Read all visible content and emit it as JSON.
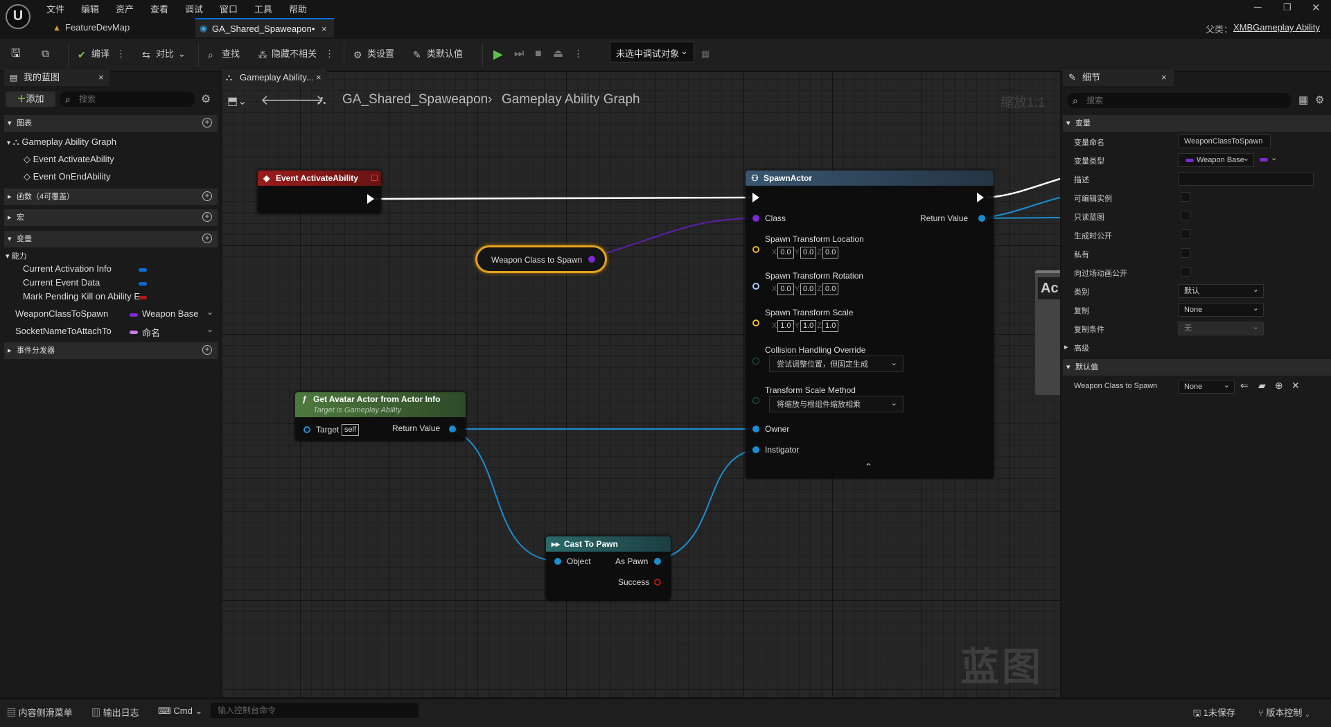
{
  "menu": {
    "items": [
      "文件",
      "编辑",
      "资产",
      "查看",
      "调试",
      "窗口",
      "工具",
      "帮助"
    ]
  },
  "doc_tabs": [
    {
      "label": "FeatureDevMap"
    },
    {
      "label": "GA_Shared_Spaweapon•"
    }
  ],
  "parent_class": {
    "label": "父类：",
    "value": "XMBGameplay Ability"
  },
  "toolbar": {
    "compile": "编译",
    "diff": "对比",
    "find": "查找",
    "hide_unrelated": "隐藏不相关",
    "class_settings": "类设置",
    "class_defaults": "类默认值",
    "debug_target": "未选中调试对象"
  },
  "my_blueprint": {
    "tab": "我的蓝图",
    "add": "添加",
    "search_placeholder": "搜索",
    "graphs_cat": "图表",
    "graph_name": "Gameplay Ability Graph",
    "events": [
      "Event ActivateAbility",
      "Event OnEndAbility"
    ],
    "functions_cat": "函数（4可覆盖）",
    "macros_cat": "宏",
    "variables_cat": "变量",
    "ability_group": "能力",
    "ability_vars": [
      {
        "name": "Current Activation Info",
        "color": "#0a6bd8"
      },
      {
        "name": "Current Event Data",
        "color": "#0a6bd8"
      },
      {
        "name": "Mark Pending Kill on Ability E",
        "color": "#b01818"
      }
    ],
    "vars": [
      {
        "name": "WeaponClassToSpawn",
        "type": "Weapon Base",
        "color": "#7a2bd6"
      },
      {
        "name": "SocketNameToAttachTo",
        "type": "命名",
        "color": "#c77ae8"
      }
    ],
    "dispatchers_cat": "事件分发器"
  },
  "graph": {
    "tab": "Gameplay Ability...",
    "breadcrumb": [
      "GA_Shared_Spaweapon",
      "Gameplay Ability Graph"
    ],
    "zoom": "缩放1:1",
    "watermark": "蓝图",
    "event_node": {
      "title": "Event ActivateAbility"
    },
    "var_node": {
      "label": "Weapon Class to Spawn"
    },
    "spawn_node": {
      "title": "SpawnActor",
      "class": "Class",
      "return_value": "Return Value",
      "loc": "Spawn Transform Location",
      "rot": "Spawn Transform Rotation",
      "scale": "Spawn Transform Scale",
      "loc_vals": [
        "0.0",
        "0.0",
        "0.0"
      ],
      "rot_vals": [
        "0.0",
        "0.0",
        "0.0"
      ],
      "scale_vals": [
        "1.0",
        "1.0",
        "1.0"
      ],
      "axes": [
        "X",
        "Y",
        "Z"
      ],
      "collision": "Collision Handling Override",
      "collision_val": "尝试调整位置，但固定生成",
      "scale_method": "Transform Scale Method",
      "scale_method_val": "将缩放与根组件缩放相乘",
      "owner": "Owner",
      "instigator": "Instigator"
    },
    "avatar_node": {
      "title": "Get Avatar Actor from Actor Info",
      "subtitle": "Target is Gameplay Ability",
      "target": "Target",
      "target_val": "self",
      "return_value": "Return Value"
    },
    "cast_node": {
      "title": "Cast To Pawn",
      "object": "Object",
      "as_pawn": "As Pawn",
      "success": "Success"
    },
    "partial_node": {
      "label": "Ac"
    }
  },
  "details": {
    "tab": "细节",
    "search_placeholder": "搜索",
    "var_cat": "变量",
    "var_name_label": "变量命名",
    "var_name": "WeaponClassToSpawn",
    "var_type_label": "变量类型",
    "var_type": "Weapon Base",
    "desc_label": "描述",
    "checks": [
      "可编辑实例",
      "只读蓝图",
      "生成时公开",
      "私有",
      "向过场动画公开"
    ],
    "category_label": "类别",
    "category": "默认",
    "replication_label": "复制",
    "replication": "None",
    "rep_cond_label": "复制条件",
    "rep_cond": "无",
    "advanced": "高级",
    "defaults_cat": "默认值",
    "default_var": "Weapon Class to Spawn",
    "default_val": "None"
  },
  "status": {
    "drawer": "内容侧滑菜单",
    "log": "输出日志",
    "cmd": "Cmd",
    "console_placeholder": "输入控制台命令",
    "unsaved": "1未保存",
    "source_control": "版本控制"
  }
}
